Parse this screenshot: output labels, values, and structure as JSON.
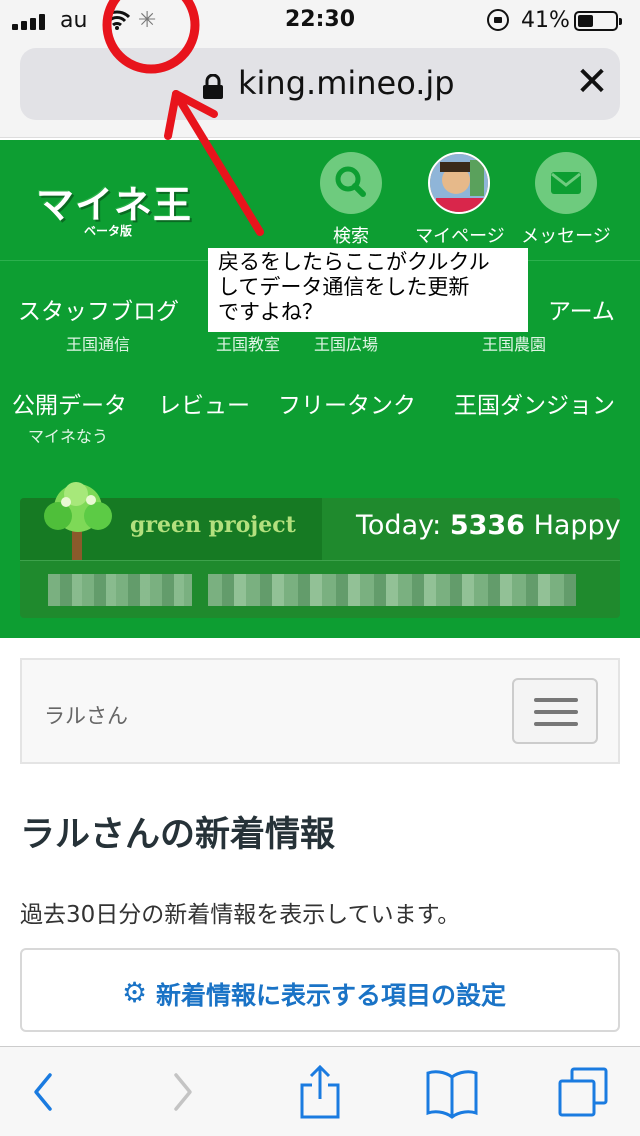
{
  "status_bar": {
    "carrier": "au",
    "time": "22:30",
    "battery": "41%",
    "battery_level": 0.41
  },
  "browser": {
    "url": "king.mineo.jp"
  },
  "header": {
    "logo_text": "マイネ王",
    "logo_sub": "ベータ版",
    "search_label": "検索",
    "mypage_label": "マイページ",
    "message_label": "メッセージ"
  },
  "nav": {
    "row1": [
      {
        "label": "スタッフブログ",
        "sub": "王国通信"
      },
      {
        "label": "",
        "sub": "王国教室"
      },
      {
        "label": "",
        "sub": "王国広場"
      },
      {
        "label": "アーム",
        "sub": "王国農園"
      }
    ],
    "row2": [
      {
        "label": "公開データ",
        "sub": "マイネなう"
      },
      {
        "label": "レビュー",
        "sub": ""
      },
      {
        "label": "フリータンク",
        "sub": ""
      },
      {
        "label": "王国ダンジョン",
        "sub": ""
      }
    ]
  },
  "annotation": {
    "lines": [
      "戻るをしたらここがクルクル",
      "してデータ通信をした更新",
      "ですよね？"
    ]
  },
  "green_project": {
    "logo_text": "green project",
    "today_label": "Today:",
    "today_count": "5336",
    "today_unit": "Happy"
  },
  "content": {
    "username": "ラルさん",
    "title": "ラルさんの新着情報",
    "description": "過去30日分の新着情報を表示しています。",
    "settings_button": "新着情報に表示する項目の設定"
  },
  "colors": {
    "header_green": "#0d9e32",
    "link_blue": "#1a73c6",
    "annotation_red": "#e8141c"
  },
  "icons": [
    "signal-icon",
    "wifi-icon",
    "spinner-icon",
    "rotation-lock-icon",
    "battery-icon",
    "padlock-icon",
    "close-icon",
    "search-icon",
    "avatar-icon",
    "mail-icon",
    "tree-icon",
    "menu-icon",
    "gear-icon",
    "back-icon",
    "forward-icon",
    "share-icon",
    "bookmarks-icon",
    "tabs-icon"
  ]
}
